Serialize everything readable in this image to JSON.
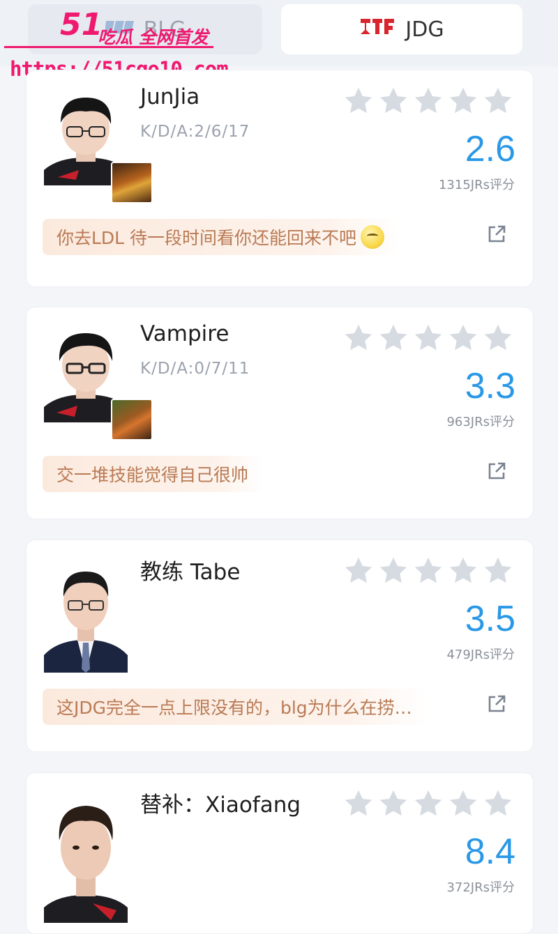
{
  "tabs": {
    "left": {
      "label": "BLG",
      "active": false
    },
    "right": {
      "label": "JDG",
      "active": true
    }
  },
  "watermark": {
    "brand_num": "51",
    "brand_text": "吃瓜 全网首发",
    "url": "https://51cgo10.com"
  },
  "colors": {
    "score": "#2a98e6",
    "star_empty": "#d6dbe2",
    "comment_text": "#b97a54",
    "comment_bg": "#fbe9dd"
  },
  "players": [
    {
      "name": "JunJia",
      "kda": "K/D/A:2/6/17",
      "score": "2.6",
      "ratings": "1315JRs评分",
      "comment": "你去LDL 待一段时间看你还能回来不吧",
      "has_emoji": true,
      "stars_filled": 0
    },
    {
      "name": "Vampire",
      "kda": "K/D/A:0/7/11",
      "score": "3.3",
      "ratings": "963JRs评分",
      "comment": "交一堆技能觉得自己很帅",
      "has_emoji": false,
      "stars_filled": 0
    },
    {
      "name": "教练 Tabe",
      "kda": "",
      "score": "3.5",
      "ratings": "479JRs评分",
      "comment": "这JDG完全一点上限没有的，blg为什么在捞…",
      "has_emoji": false,
      "stars_filled": 0
    },
    {
      "name": "替补：Xiaofang",
      "kda": "",
      "score": "8.4",
      "ratings": "372JRs评分",
      "comment": "",
      "has_emoji": false,
      "stars_filled": 0
    }
  ]
}
